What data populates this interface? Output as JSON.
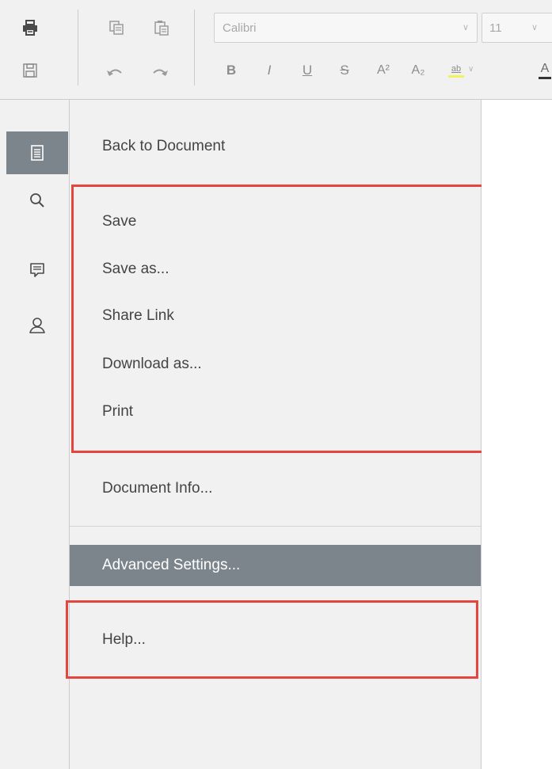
{
  "toolbar": {
    "font_name": "Calibri",
    "font_size": "11",
    "icons": [
      "printer-icon",
      "save-icon",
      "copy-icon",
      "paste-icon",
      "undo-icon",
      "redo-icon",
      "bold-icon",
      "italic-icon",
      "underline-icon",
      "strikethrough-icon",
      "superscript-icon",
      "subscript-icon",
      "highlight-icon",
      "font-color-icon"
    ],
    "format": {
      "bold": "B",
      "italic": "I",
      "underline": "U",
      "strike": "S",
      "superscript": "A²",
      "subscript": "A₂",
      "highlight": "ab",
      "font_color": "A"
    },
    "highlight_color": "#f2f25a",
    "font_color_bar": "#333333"
  },
  "leftbar": {
    "items": [
      "file-icon",
      "search-icon",
      "comment-icon",
      "user-icon"
    ],
    "active": "file-icon"
  },
  "menu": {
    "items": [
      {
        "label": "Back to Document"
      },
      {
        "label": "Save"
      },
      {
        "label": "Save as..."
      },
      {
        "label": "Share Link"
      },
      {
        "label": "Download as..."
      },
      {
        "label": "Print"
      },
      {
        "label": "Document Info..."
      },
      {
        "label": "Advanced Settings..."
      },
      {
        "label": "Help..."
      }
    ],
    "selected": "Advanced Settings..."
  },
  "colors": {
    "highlight_box": "#e5453f",
    "selected_bg": "#7d858c",
    "panel_bg": "#f1f1f1"
  }
}
